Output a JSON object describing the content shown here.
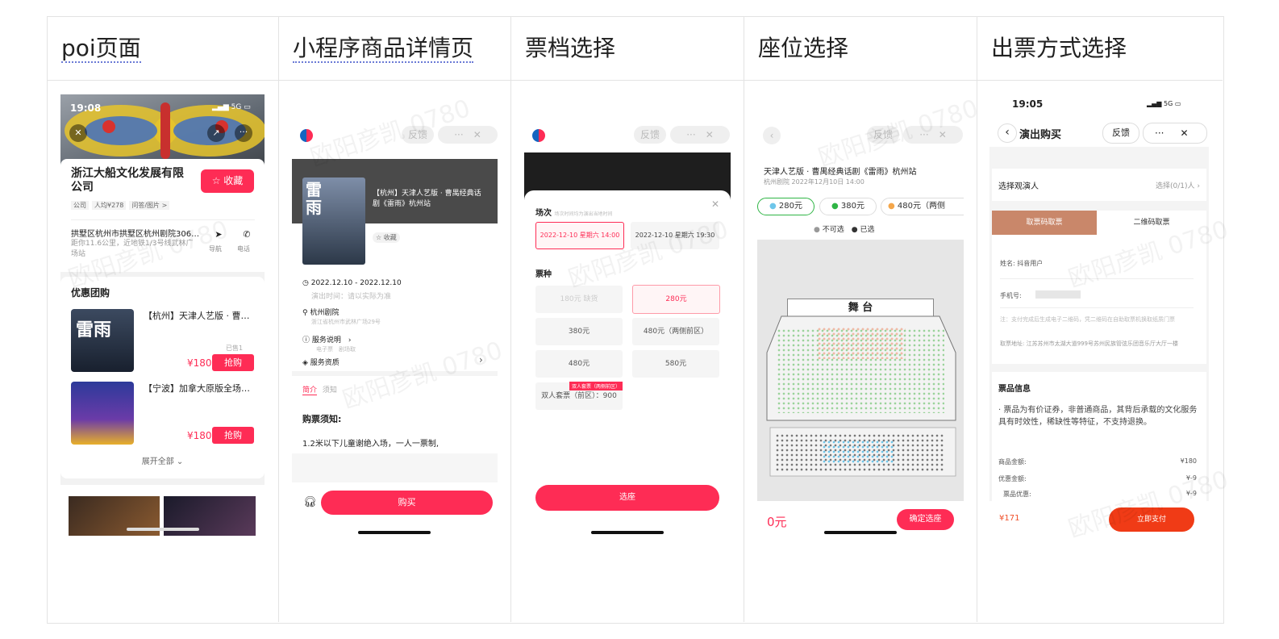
{
  "headers": [
    "poi页面",
    "小程序商品详情页",
    "票档选择",
    "座位选择",
    "出票方式选择"
  ],
  "watermark": "欧阳彦凯 0780",
  "poi": {
    "time": "19:08",
    "signal": "5G",
    "shop_name": "浙江大船文化发展有限公司",
    "favorite_label": "收藏",
    "tags": [
      "公司",
      "人均¥278",
      "问答/图片 >"
    ],
    "address": "拱墅区杭州市拱墅区杭州剧院306…",
    "distance": "距你11.6公里，近地铁1/3号线武林广场站",
    "nav_label": "导航",
    "phone_label": "电话",
    "section_title": "优惠团购",
    "deals": [
      {
        "title": "【杭州】天津人艺版 · 曹…",
        "sold": "已售1",
        "price": "¥180",
        "buy": "抢购"
      },
      {
        "title": "【宁波】加拿大原版全场…",
        "sold": "",
        "price": "¥180",
        "buy": "抢购"
      }
    ],
    "expand": "展开全部"
  },
  "detail": {
    "feedback": "反馈",
    "more": "···",
    "close": "✕",
    "poster_title": "【杭州】天津人艺版 · 曹禺经典话剧《雷雨》杭州站",
    "fav": "☆ 收藏",
    "date_range": "2022.12.10 - 2022.12.10",
    "date_note": "演出时间：请以实际为准",
    "venue": "杭州剧院",
    "venue_addr": "浙江省杭州市武林广场29号",
    "service": "服务说明",
    "service_tags": "电子票　剧场取",
    "qualification": "服务资质",
    "tabs": [
      "简介",
      "须知"
    ],
    "notice_title": "购票须知:",
    "notice_text": "1.2米以下儿童谢绝入场，一人一票制,",
    "buy": "购买"
  },
  "tier": {
    "session_label": "场次",
    "session_note": "场次时间均为演出当地时间",
    "sessions": [
      "2022-12-10 星期六 14:00",
      "2022-12-10 星期六 19:30"
    ],
    "ticket_label": "票种",
    "tickets": [
      "180元 缺货",
      "280元",
      "380元",
      "480元（两侧前区）",
      "480元",
      "580元",
      "双人套票（前区）：900"
    ],
    "combo_badge": "双人套票（两侧前区）",
    "select_btn": "选座"
  },
  "seat": {
    "show_title": "天津人艺版 · 曹禺经典话剧《雷雨》杭州站",
    "venue_time": "杭州剧院 2022年12月10日 14:00",
    "prices": [
      "280元",
      "380元",
      "480元（两侧"
    ],
    "price_colors": [
      "#6ec6ea",
      "#2fb545",
      "#f4a64a"
    ],
    "legend": [
      "不可选",
      "已选"
    ],
    "stage": "舞 台",
    "total": "0元",
    "confirm": "确定选座"
  },
  "ticket": {
    "time": "19:05",
    "signal": "5G",
    "title": "演出购买",
    "feedback": "反馈",
    "viewer_label": "选择观演人",
    "viewer_value": "选择(0/1)人",
    "tabs": [
      "取票码取票",
      "二维码取票"
    ],
    "name_label": "姓名:",
    "name_value": "抖音用户",
    "phone_label": "手机号:",
    "note": "注：支付完成后生成电子二维码，凭二维码在自助取票机换取纸质门票",
    "pickup_label": "取票地址:",
    "pickup_value": "江苏苏州市太湖大道999号苏州民族管弦乐团音乐厅大厅一楼",
    "info_title": "票品信息",
    "info_text": "· 票品为有价证券，非普通商品，其背后承载的文化服务具有时效性，稀缺性等特征，不支持退换。",
    "rows": [
      {
        "label": "商品金额:",
        "value": "¥180"
      },
      {
        "label": "优惠金额:",
        "value": "¥-9"
      },
      {
        "label": "票品优惠:",
        "value": "¥-9"
      }
    ],
    "total": "¥171",
    "pay": "立即支付"
  }
}
